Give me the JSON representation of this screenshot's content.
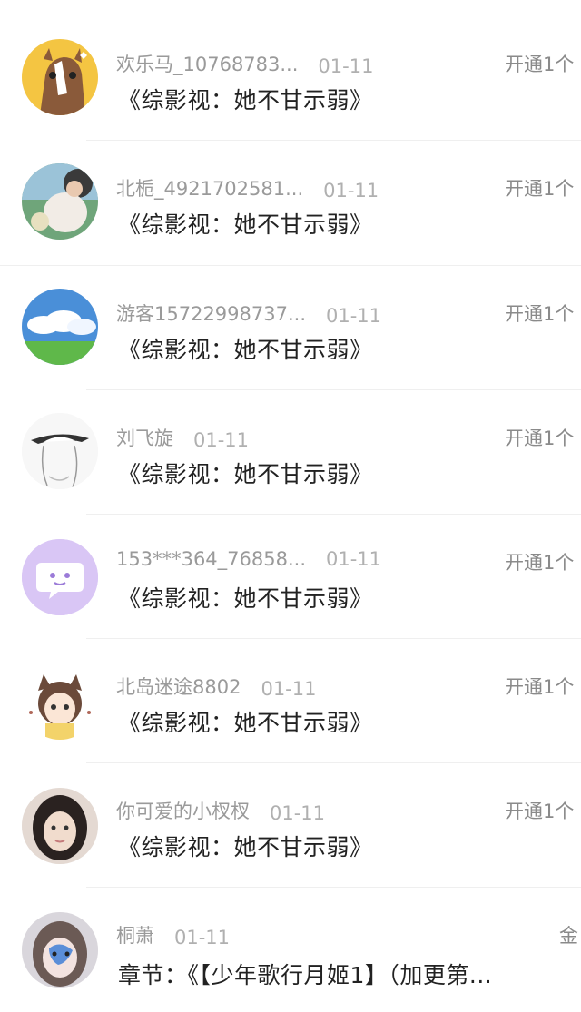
{
  "activity_feed": {
    "items": [
      {
        "username": "欢乐马_10768783...",
        "date": "01-11",
        "action": "开通1个",
        "content": "《综影视：她不甘示弱》",
        "avatar": "horse-cartoon-avatar"
      },
      {
        "username": "北栀_4921702581...",
        "date": "01-11",
        "action": "开通1个",
        "content": "《综影视：她不甘示弱》",
        "avatar": "girl-photo-avatar"
      },
      {
        "username": "游客15722998737...",
        "date": "01-11",
        "action": "开通1个",
        "content": "《综影视：她不甘示弱》",
        "avatar": "sky-clouds-avatar"
      },
      {
        "username": "刘飞旋",
        "date": "01-11",
        "action": "开通1个",
        "content": "《综影视：她不甘示弱》",
        "avatar": "hat-girl-sketch-avatar"
      },
      {
        "username": "153***364_76858...",
        "date": "01-11",
        "action": "开通1个",
        "content": "《综影视：她不甘示弱》",
        "avatar": "chat-bubble-avatar"
      },
      {
        "username": "北岛迷途8802",
        "date": "01-11",
        "action": "开通1个",
        "content": "《综影视：她不甘示弱》",
        "avatar": "anime-cat-girl-avatar"
      },
      {
        "username": "你可爱的小杈杈",
        "date": "01-11",
        "action": "开通1个",
        "content": "《综影视：她不甘示弱》",
        "avatar": "woman-selfie-avatar"
      },
      {
        "username": "桐萧",
        "date": "01-11",
        "action": "金",
        "content": "章节：《【少年歌行月姬1】（加更第...",
        "avatar": "blue-face-paint-avatar"
      }
    ]
  },
  "colors": {
    "username_text": "#9a9a9a",
    "date_text": "#b0b0b0",
    "content_text": "#222222",
    "divider": "#efefef",
    "chat_avatar_bg": "#d9c6f5"
  }
}
